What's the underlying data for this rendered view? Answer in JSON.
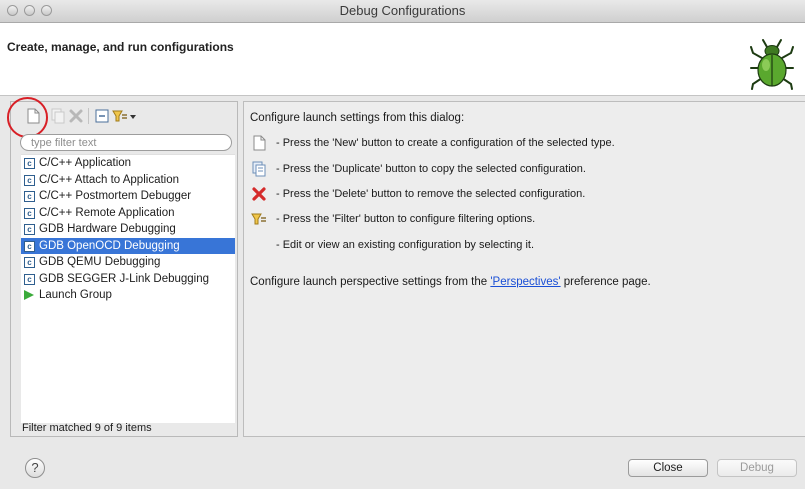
{
  "window": {
    "title": "Debug Configurations"
  },
  "header": {
    "text": "Create, manage, and run configurations"
  },
  "sidebar": {
    "filter_placeholder": "type filter text",
    "items": [
      {
        "label": "C/C++ Application",
        "icon": "c-config-icon"
      },
      {
        "label": "C/C++ Attach to Application",
        "icon": "c-config-icon"
      },
      {
        "label": "C/C++ Postmortem Debugger",
        "icon": "c-config-icon"
      },
      {
        "label": "C/C++ Remote Application",
        "icon": "c-config-icon"
      },
      {
        "label": "GDB Hardware Debugging",
        "icon": "c-config-icon"
      },
      {
        "label": "GDB OpenOCD Debugging",
        "icon": "c-config-icon",
        "selected": true
      },
      {
        "label": "GDB QEMU Debugging",
        "icon": "c-config-icon"
      },
      {
        "label": "GDB SEGGER J-Link Debugging",
        "icon": "c-config-icon"
      },
      {
        "label": "Launch Group",
        "icon": "launch-group-icon"
      }
    ],
    "status": "Filter matched 9 of 9 items"
  },
  "main": {
    "intro": "Configure launch settings from this dialog:",
    "instructions": [
      {
        "text": "- Press the 'New' button to create a configuration of the selected type.",
        "icon": "new-config-icon"
      },
      {
        "text": "- Press the 'Duplicate' button to copy the selected configuration.",
        "icon": "duplicate-icon"
      },
      {
        "text": "- Press the 'Delete' button to remove the selected configuration.",
        "icon": "delete-icon"
      },
      {
        "text": "- Press the 'Filter' button to configure filtering options.",
        "icon": "filter-icon"
      },
      {
        "text": "- Edit or view an existing configuration by selecting it.",
        "icon": ""
      }
    ],
    "perspective_prefix": "Configure launch perspective settings from the ",
    "perspective_link": "'Perspectives'",
    "perspective_suffix": " preference page."
  },
  "footer": {
    "help": "?",
    "close_label": "Close",
    "debug_label": "Debug"
  },
  "colors": {
    "selection": "#3875d7",
    "highlight_circle": "#d81f26",
    "link": "#1a4fd6"
  }
}
